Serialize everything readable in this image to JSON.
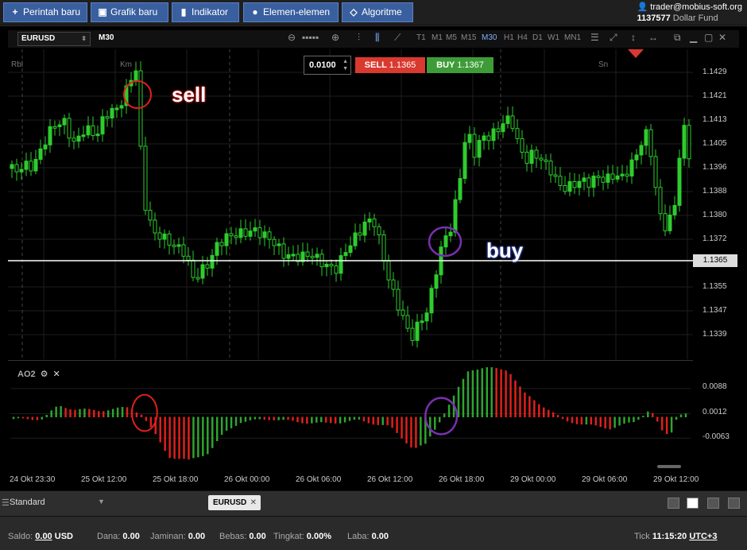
{
  "toolbar": {
    "new_order": "Perintah baru",
    "new_chart": "Grafik baru",
    "indicator": "Indikator",
    "elements": "Elemen-elemen",
    "algorithm": "Algoritme"
  },
  "account": {
    "email": "trader@mobius-soft.org",
    "id": "1137577",
    "fund": "Dollar Fund"
  },
  "chart": {
    "symbol": "EURUSD",
    "timeframe": "M30",
    "timeframes": [
      "T1",
      "M1",
      "M5",
      "M15",
      "M30",
      "H1",
      "H4",
      "D1",
      "W1",
      "MN1"
    ],
    "active_timeframe": "M30",
    "day_labels": [
      "Rbl",
      "Km",
      "Sn"
    ],
    "price_labels": [
      "1.1429",
      "1.1421",
      "1.1413",
      "1.1405",
      "1.1396",
      "1.1388",
      "1.1380",
      "1.1372",
      "1.1365",
      "1.1355",
      "1.1347",
      "1.1339"
    ],
    "current_price": "1.1365",
    "time_labels": [
      "24 Okt 23:30",
      "25 Okt 12:00",
      "25 Okt 18:00",
      "26 Okt 00:00",
      "26 Okt 06:00",
      "26 Okt 12:00",
      "26 Okt 18:00",
      "29 Okt 00:00",
      "29 Okt 06:00",
      "29 Okt 12:00"
    ],
    "colors": {
      "up": "#2ecc2e",
      "down": "#2ecc2e",
      "ao_up": "#2fa52f",
      "ao_down": "#e0201b",
      "current_line": "#ffffff"
    }
  },
  "trade": {
    "lot": "0.0100",
    "sell_label": "SELL",
    "sell_price": "1.1365",
    "buy_label": "BUY",
    "buy_price": "1.1367"
  },
  "indicator": {
    "name": "AO2",
    "levels": [
      "0.0088",
      "0.0012",
      "-0.0063"
    ]
  },
  "annotations": {
    "sell": "sell",
    "buy": "buy"
  },
  "tabs": {
    "workspace": "Standard",
    "chart_tab": "EURUSD"
  },
  "status": {
    "saldo_label": "Saldo:",
    "saldo_value": "0.00",
    "saldo_ccy": "USD",
    "dana_label": "Dana:",
    "dana_value": "0.00",
    "jaminan_label": "Jaminan:",
    "jaminan_value": "0.00",
    "bebas_label": "Bebas:",
    "bebas_value": "0.00",
    "tingkat_label": "Tingkat:",
    "tingkat_value": "0.00%",
    "laba_label": "Laba:",
    "laba_value": "0.00",
    "tick_label": "Tick",
    "time": "11:15:20",
    "tz": "UTC+3"
  }
}
